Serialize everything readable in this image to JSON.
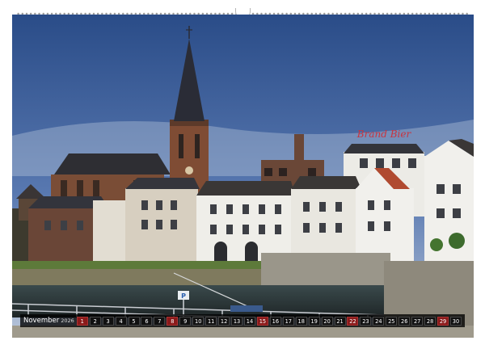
{
  "calendar": {
    "month": "November",
    "year": "2026",
    "days": [
      "1",
      "2",
      "3",
      "4",
      "5",
      "6",
      "7",
      "8",
      "9",
      "10",
      "11",
      "12",
      "13",
      "14",
      "15",
      "16",
      "17",
      "18",
      "19",
      "20",
      "21",
      "22",
      "23",
      "24",
      "25",
      "26",
      "27",
      "28",
      "29",
      "30"
    ],
    "sundays": [
      "1",
      "8",
      "15",
      "22",
      "29"
    ],
    "colors": {
      "bar": "#1b1b1b",
      "sunday": "#8b1a1a",
      "text": "#ffffff"
    }
  },
  "photo": {
    "sign_text": "Brand Bier",
    "colors": {
      "sky_top": "#2d4f8a",
      "sky_bottom": "#b7c4d9",
      "water": "#2e3a3c",
      "brick": "#8a5a40"
    }
  }
}
